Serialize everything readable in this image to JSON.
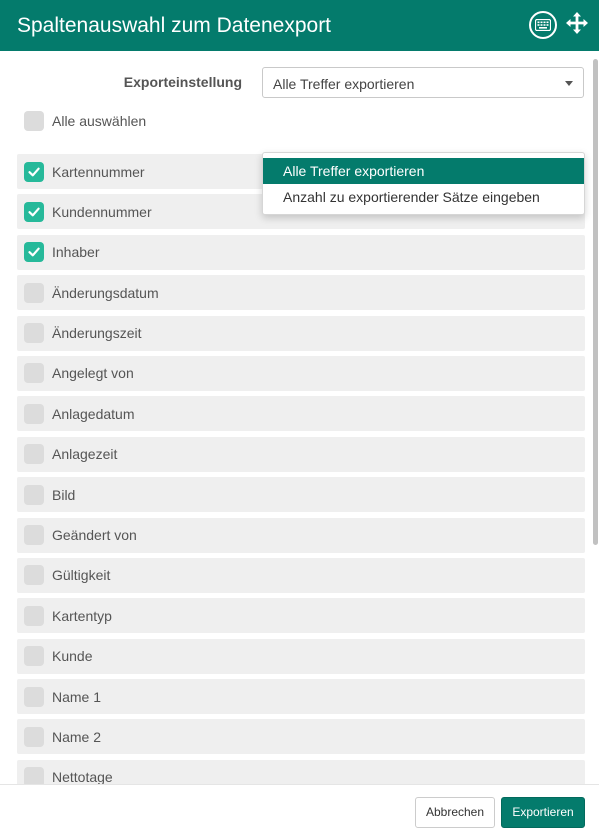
{
  "dialog": {
    "title": "Spaltenauswahl zum Datenexport",
    "icons": {
      "keyboard": "keyboard-icon",
      "move": "move-arrows-icon"
    }
  },
  "export_setting": {
    "label": "Exporteinstellung",
    "selected": "Alle Treffer exportieren",
    "options": [
      {
        "label": "Alle Treffer exportieren",
        "selected": true
      },
      {
        "label": "Anzahl zu exportierender Sätze eingeben",
        "selected": false
      }
    ]
  },
  "select_all": {
    "label": "Alle auswählen",
    "checked": false
  },
  "columns": [
    {
      "label": "Kartennummer",
      "checked": true
    },
    {
      "label": "Kundennummer",
      "checked": true
    },
    {
      "label": "Inhaber",
      "checked": true
    },
    {
      "label": "Änderungsdatum",
      "checked": false
    },
    {
      "label": "Änderungszeit",
      "checked": false
    },
    {
      "label": "Angelegt von",
      "checked": false
    },
    {
      "label": "Anlagedatum",
      "checked": false
    },
    {
      "label": "Anlagezeit",
      "checked": false
    },
    {
      "label": "Bild",
      "checked": false
    },
    {
      "label": "Geändert von",
      "checked": false
    },
    {
      "label": "Gültigkeit",
      "checked": false
    },
    {
      "label": "Kartentyp",
      "checked": false
    },
    {
      "label": "Kunde",
      "checked": false
    },
    {
      "label": "Name 1",
      "checked": false
    },
    {
      "label": "Name 2",
      "checked": false
    },
    {
      "label": "Nettotage",
      "checked": false
    }
  ],
  "footer": {
    "cancel_label": "Abbrechen",
    "export_label": "Exportieren"
  },
  "colors": {
    "primary": "#047b6c",
    "checkbox_checked": "#26b99a",
    "checkbox_unchecked": "#dcdcdc",
    "row_background": "#efefef"
  }
}
